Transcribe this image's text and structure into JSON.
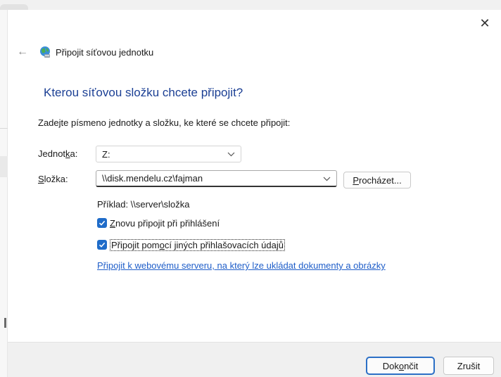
{
  "window": {
    "title": "Připojit síťovou jednotku",
    "close_glyph": "✕",
    "back_glyph": "←"
  },
  "main": {
    "heading": "Kterou síťovou složku chcete připojit?",
    "instruction": "Zadejte písmeno jednotky a složku, ke které se chcete připojit:",
    "drive_label_pre": "Jednot",
    "drive_label_key": "k",
    "drive_label_post": "a:",
    "drive_value": "Z:",
    "folder_label_key": "S",
    "folder_label_post": "ložka:",
    "folder_value": "\\\\disk.mendelu.cz\\fajman",
    "browse_key": "P",
    "browse_post": "rocházet...",
    "example": "Příklad: \\\\server\\složka",
    "reconnect_key": "Z",
    "reconnect_post": "novu připojit při přihlášení",
    "reconnect_checked": true,
    "other_creds_pre": "Připojit pom",
    "other_creds_key": "o",
    "other_creds_post": "cí jiných přihlašovacích údajů",
    "other_creds_checked": true,
    "web_link": "Připojit k webovému serveru, na který lze ukládat dokumenty a obrázky"
  },
  "footer": {
    "finish_pre": "Dok",
    "finish_key": "o",
    "finish_post": "nčit",
    "cancel": "Zrušit"
  },
  "colors": {
    "heading": "#1b3f94",
    "link": "#1f5ec9",
    "checkbox": "#1f6cc9",
    "default_button_border": "#2b6fc6"
  },
  "icons": {
    "network_drive": "globe-network-icon",
    "back": "back-arrow-icon",
    "close": "close-icon",
    "dropdown": "chevron-down-icon",
    "checkmark": "checkmark-icon"
  }
}
